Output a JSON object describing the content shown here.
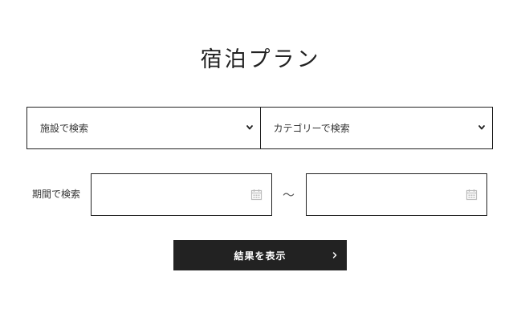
{
  "page": {
    "title": "宿泊プラン"
  },
  "filters": {
    "facility": {
      "label": "施設で検索",
      "icon": "chevron-down-icon"
    },
    "category": {
      "label": "カテゴリーで検索",
      "icon": "chevron-down-icon"
    },
    "period": {
      "label": "期間で検索",
      "start_value": "",
      "end_value": "",
      "separator": "～",
      "icon": "calendar-icon"
    }
  },
  "submit": {
    "label": "結果を表示",
    "icon": "chevron-right-icon"
  },
  "colors": {
    "text": "#222222",
    "border": "#222222",
    "button_bg": "#222222",
    "button_text": "#ffffff",
    "icon_muted": "#bbbbbb"
  }
}
